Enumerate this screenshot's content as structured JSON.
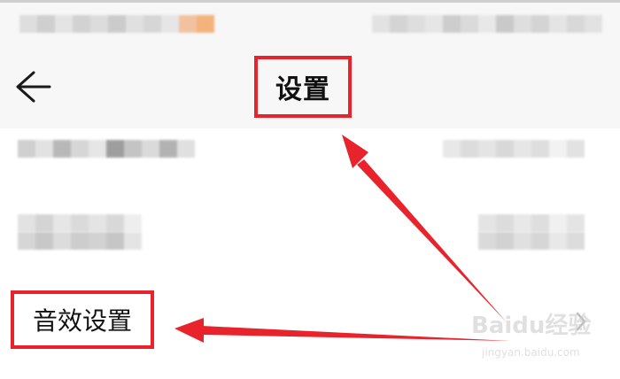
{
  "header": {
    "title": "设置"
  },
  "settings": {
    "sound_effects_label": "音效设置"
  },
  "icons": {
    "back": "arrow-left-icon",
    "chevron": "chevron-right-icon"
  },
  "watermark": {
    "brand": "Baidu经验",
    "url": "jingyan.baidu.com"
  },
  "colors": {
    "highlight": "#e8232b",
    "header_bg": "#f7f7f7",
    "text": "#111111"
  }
}
